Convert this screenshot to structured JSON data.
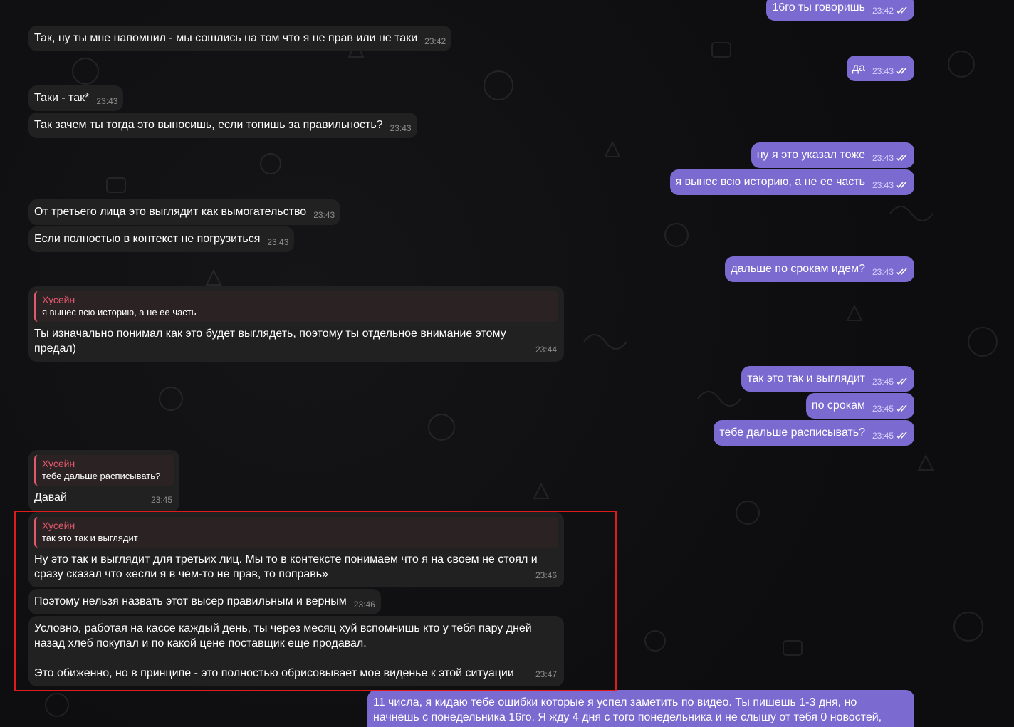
{
  "colors": {
    "incoming_bubble": "#212121",
    "outgoing_bubble": "#7b6bd1",
    "reply_accent": "#e2596c",
    "highlight_border": "#e01b1b"
  },
  "icons": {
    "read_status": "double-check-icon"
  },
  "messages": [
    {
      "text": "16го ты говоришь",
      "time": "23:42"
    },
    {
      "text": "Так, ну ты мне напомнил - мы сошлись на том что я не прав или не таки",
      "time": "23:42"
    },
    {
      "text": "да",
      "time": "23:43"
    },
    {
      "text": "Таки - так*",
      "time": "23:43"
    },
    {
      "text": "Так зачем ты тогда это выносишь, если топишь за правильность?",
      "time": "23:43"
    },
    {
      "text": "ну я это указал тоже",
      "time": "23:43"
    },
    {
      "text": "я вынес всю историю, а не ее часть",
      "time": "23:43"
    },
    {
      "text": "От третьего лица это выглядит как вымогательство",
      "time": "23:43"
    },
    {
      "text": "Если полностью в контекст не погрузиться",
      "time": "23:43"
    },
    {
      "text": "дальше по срокам идем?",
      "time": "23:43"
    },
    {
      "reply_name": "Хусейн",
      "reply_text": "я вынес всю историю, а не ее часть",
      "text": "Ты изначально понимал как это будет выглядеть, поэтому ты отдельное внимание этому\nпредал)",
      "time": "23:44"
    },
    {
      "text": "так это так и выглядит",
      "time": "23:45"
    },
    {
      "text": "по срокам",
      "time": "23:45"
    },
    {
      "text": "тебе дальше расписывать?",
      "time": "23:45"
    },
    {
      "reply_name": "Хусейн",
      "reply_text": "тебе дальше расписывать?",
      "text": "Давай",
      "time": "23:45"
    },
    {
      "reply_name": "Хусейн",
      "reply_text": "так это так и выглядит",
      "text": "Ну это так и выглядит для третьих лиц. Мы то в контексте понимаем что я на своем не стоял и\nсразу сказал что «если я в чем-то не прав, то поправь»",
      "time": "23:46"
    },
    {
      "text": "Поэтому нельзя назвать этот высер правильным и верным",
      "time": "23:46"
    },
    {
      "text": "Условно, работая на кассе каждый день, ты через месяц хуй вспомнишь кто у тебя пару дней\nназад хлеб покупал и по какой цене поставщик еще продавал.\n\nЭто обиженно, но в принципе - это полностью обрисовывает мое виденье к этой ситуации",
      "time": "23:47"
    },
    {
      "text": "11 числа, я кидаю тебе ошибки которые я успел заметить по видео. Ты пишешь 1-3 дня, но\nначнешь с понедельника 16го. Я жду 4 дня с того понедельника и не слышу от тебя 0 новостей,"
    }
  ]
}
